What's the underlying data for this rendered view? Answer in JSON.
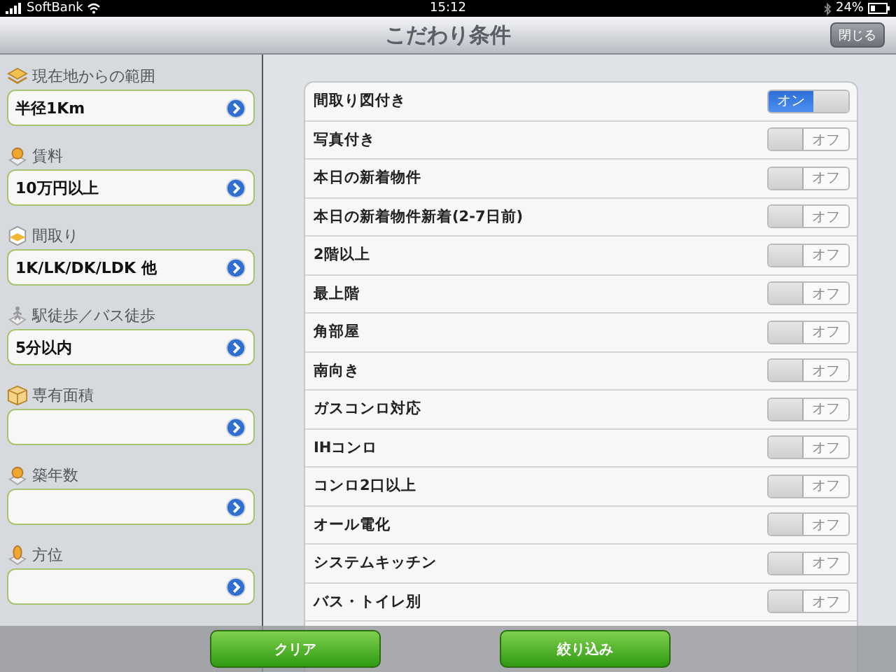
{
  "status_bar": {
    "carrier": "SoftBank",
    "time": "15:12",
    "battery": "24%"
  },
  "nav_bar": {
    "title": "こだわり条件",
    "close_button": "閉じる"
  },
  "filters": [
    {
      "label": "現在地からの範囲",
      "value": "半径1Km"
    },
    {
      "label": "賃料",
      "value": "10万円以上"
    },
    {
      "label": "間取り",
      "value": "1K/LK/DK/LDK 他"
    },
    {
      "label": "駅徒歩／バス徒歩",
      "value": "5分以内"
    },
    {
      "label": "専有面積"
    },
    {
      "label": "築年数"
    },
    {
      "label": "方位"
    }
  ],
  "options": [
    {
      "label": "間取り図付き",
      "on": true,
      "switch_text": "オン"
    },
    {
      "label": "写真付き",
      "on": false,
      "switch_text": "オフ"
    },
    {
      "label": "本日の新着物件",
      "on": false,
      "switch_text": "オフ"
    },
    {
      "label": "本日の新着物件新着(2-7日前)",
      "on": false,
      "switch_text": "オフ"
    },
    {
      "label": "2階以上",
      "on": false,
      "switch_text": "オフ"
    },
    {
      "label": "最上階",
      "on": false,
      "switch_text": "オフ"
    },
    {
      "label": "角部屋",
      "on": false,
      "switch_text": "オフ"
    },
    {
      "label": "南向き",
      "on": false,
      "switch_text": "オフ"
    },
    {
      "label": "ガスコンロ対応",
      "on": false,
      "switch_text": "オフ"
    },
    {
      "label": "IHコンロ",
      "on": false,
      "switch_text": "オフ"
    },
    {
      "label": "コンロ2口以上",
      "on": false,
      "switch_text": "オフ"
    },
    {
      "label": "オール電化",
      "on": false,
      "switch_text": "オフ"
    },
    {
      "label": "システムキッチン",
      "on": false,
      "switch_text": "オフ"
    },
    {
      "label": "バス・トイレ別",
      "on": false,
      "switch_text": "オフ"
    }
  ],
  "toolbar": {
    "clear_button": "クリア",
    "apply_button": "絞り込み"
  }
}
